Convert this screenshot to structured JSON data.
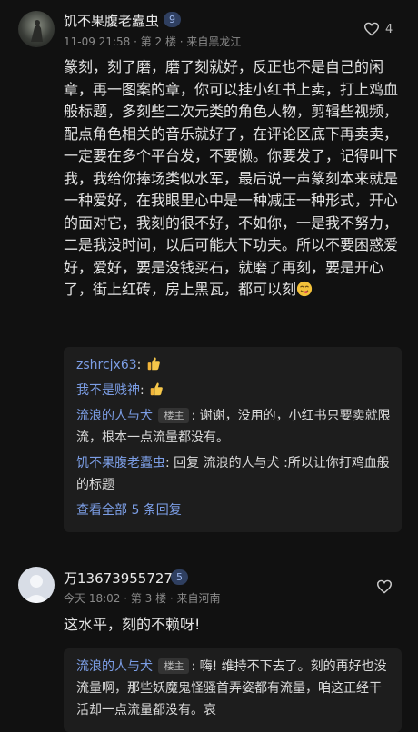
{
  "comments": [
    {
      "username": "饥不果腹老蠹虫",
      "level": "9",
      "meta": "11-09 21:58 · 第 2 楼 · 来自黑龙江",
      "like_count": "4",
      "body": "篆刻，刻了磨，磨了刻就好，反正也不是自己的闲章，再一图案的章，你可以挂小红书上卖，打上鸡血般标题，多刻些二次元类的角色人物，剪辑些视频，配点角色相关的音乐就好了，在评论区底下再卖卖，一定要在多个平台发，不要懒。你要发了，记得叫下我，我给你捧场类似水军，最后说一声篆刻本来就是一种爱好，在我眼里心中是一种减压一种形式，开心的面对它，我刻的很不好，不如你，一是我不努力，二是我没时间，以后可能大下功夫。所以不要困惑爱好，爱好，要是没钱买石，就磨了再刻，要是开心了，街上红砖，房上黑瓦，都可以刻",
      "body_emoji": "yum-face-emoji",
      "replies": [
        {
          "name": "zshrcjx63",
          "tag": "",
          "sep": ":",
          "text": "",
          "emoji": "thumbs-up-emoji"
        },
        {
          "name": "我不是贱神",
          "tag": "",
          "sep": ":",
          "text": "",
          "emoji": "thumbs-up-emoji"
        },
        {
          "name": "流浪的人与犬",
          "tag": "楼主",
          "sep": ":",
          "text": " 谢谢，没用的，小红书只要卖就限流，根本一点流量都没有。",
          "emoji": ""
        },
        {
          "name": "饥不果腹老蠹虫",
          "tag": "",
          "sep": ":",
          "text": " 回复 流浪的人与犬 :所以让你打鸡血般的标题",
          "emoji": ""
        }
      ],
      "more_replies": "查看全部 5 条回复"
    },
    {
      "username": "万13673955727",
      "level": "5",
      "meta": "今天 18:02 · 第 3 楼 · 来自河南",
      "like_count": "",
      "body": "这水平，刻的不赖呀!",
      "replies": [
        {
          "name": "流浪的人与犬",
          "tag": "楼主",
          "sep": ":",
          "text": " 嗨! 维持不下去了。刻的再好也没流量啊，那些妖魔鬼怪骚首弄姿都有流量，咱这正经干活却一点流量都没有。哀"
        }
      ]
    }
  ],
  "colors": {
    "background": "#111111",
    "link": "#7c9ee6",
    "reply_bg": "#1d1d1d",
    "level_bg": "#2f3f60"
  }
}
